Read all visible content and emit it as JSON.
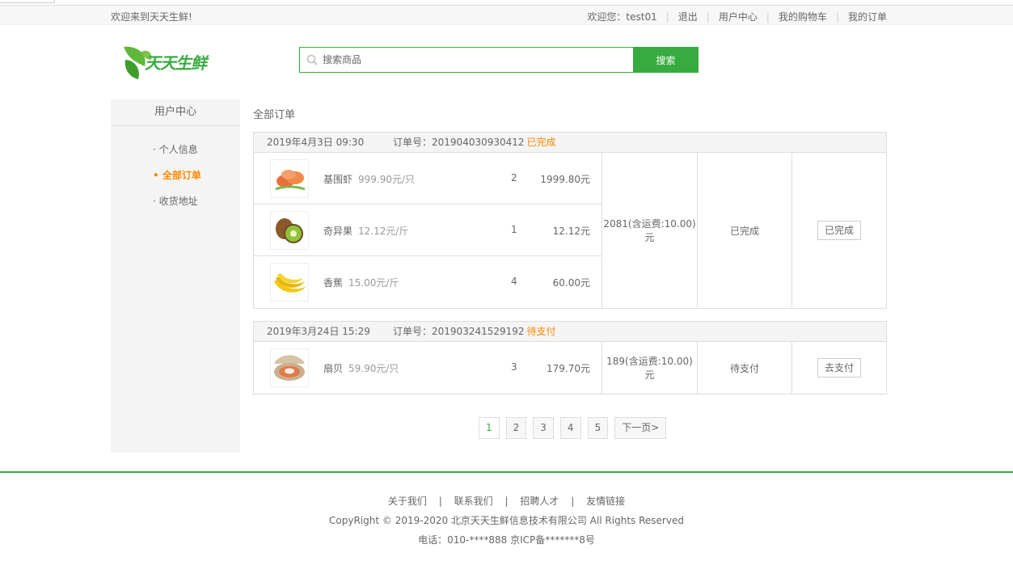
{
  "header": {
    "welcome": "欢迎来到天天生鲜!",
    "user_greeting": "欢迎您：test01",
    "logout": "退出",
    "user_center": "用户中心",
    "cart": "我的购物车",
    "orders": "我的订单"
  },
  "logo": {
    "text": "天天生鲜"
  },
  "search": {
    "placeholder": "搜索商品",
    "button": "搜索"
  },
  "sidebar": {
    "title": "用户中心",
    "items": [
      {
        "label": "· 个人信息"
      },
      {
        "label": "• 全部订单"
      },
      {
        "label": "· 收货地址"
      }
    ]
  },
  "main": {
    "title": "全部订单",
    "order_no_label": "订单号：",
    "orders": [
      {
        "date": "2019年4月3日 09:30",
        "order_no": "201904030930412",
        "status_text": "已完成",
        "goods": [
          {
            "name": "基围虾",
            "price": "999.90元/只",
            "qty": "2",
            "total": "1999.80元"
          },
          {
            "name": "奇异果",
            "price": "12.12元/斤",
            "qty": "1",
            "total": "12.12元"
          },
          {
            "name": "香蕉",
            "price": "15.00元/斤",
            "qty": "4",
            "total": "60.00元"
          }
        ],
        "amount": "2081(含运费:10.00)元",
        "state": "已完成",
        "action": "已完成"
      },
      {
        "date": "2019年3月24日 15:29",
        "order_no": "201903241529192",
        "status_text": "待支付",
        "goods": [
          {
            "name": "扇贝",
            "price": "59.90元/只",
            "qty": "3",
            "total": "179.70元"
          }
        ],
        "amount": "189(含运费:10.00)元",
        "state": "待支付",
        "action": "去支付"
      }
    ]
  },
  "pagination": {
    "pages": [
      "1",
      "2",
      "3",
      "4",
      "5"
    ],
    "current": "1",
    "next": "下一页>"
  },
  "footer": {
    "links": [
      "关于我们",
      "联系我们",
      "招聘人才",
      "友情链接"
    ],
    "separator": "|",
    "copyright": "CopyRight © 2019-2020 北京天天生鲜信息技术有限公司 All Rights Reserved",
    "phone": "电话：010-****888 京ICP备*******8号"
  },
  "colors": {
    "brand": "#37ab40",
    "accent": "#ff8800"
  },
  "icons": [
    "logo-leaf-icon",
    "search-icon",
    "shrimp-icon",
    "kiwi-icon",
    "banana-icon",
    "scallop-icon"
  ]
}
